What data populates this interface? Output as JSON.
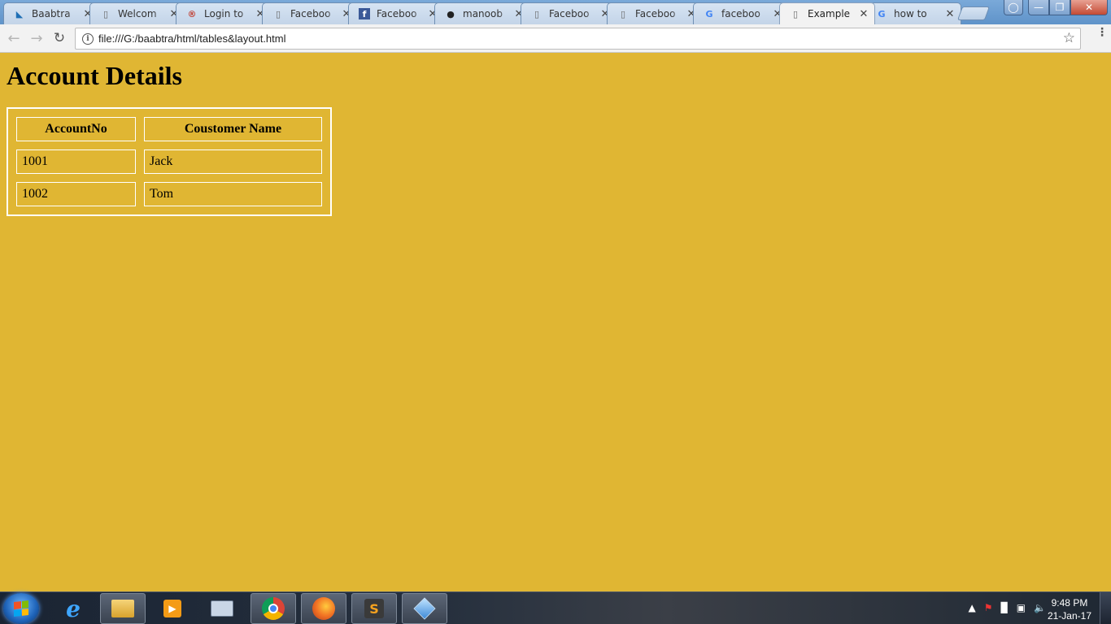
{
  "browser": {
    "tabs": [
      {
        "label": "Baabtra",
        "icon": "baabtra-icon",
        "active": false
      },
      {
        "label": "Welcom",
        "icon": "page-icon",
        "active": false
      },
      {
        "label": "Login to",
        "icon": "login-icon",
        "active": false
      },
      {
        "label": "Faceboo",
        "icon": "page-icon",
        "active": false
      },
      {
        "label": "Faceboo",
        "icon": "facebook-icon",
        "active": false
      },
      {
        "label": "manoob",
        "icon": "github-icon",
        "active": false
      },
      {
        "label": "Faceboo",
        "icon": "page-icon",
        "active": false
      },
      {
        "label": "Faceboo",
        "icon": "page-icon",
        "active": false
      },
      {
        "label": "faceboo",
        "icon": "google-icon",
        "active": false
      },
      {
        "label": "Example",
        "icon": "page-icon",
        "active": true
      },
      {
        "label": "how to",
        "icon": "google-icon",
        "active": false
      }
    ],
    "tab_close_glyph": "✕",
    "address": "file:///G:/baabtra/html/tables&layout.html"
  },
  "page": {
    "heading": "Account Details",
    "table": {
      "headers": [
        "AccountNo",
        "Coustomer Name"
      ],
      "rows": [
        [
          "1001",
          "Jack"
        ],
        [
          "1002",
          "Tom"
        ]
      ]
    },
    "background_color": "#e0b633"
  },
  "taskbar": {
    "clock_time": "9:48 PM",
    "clock_date": "21-Jan-17"
  }
}
